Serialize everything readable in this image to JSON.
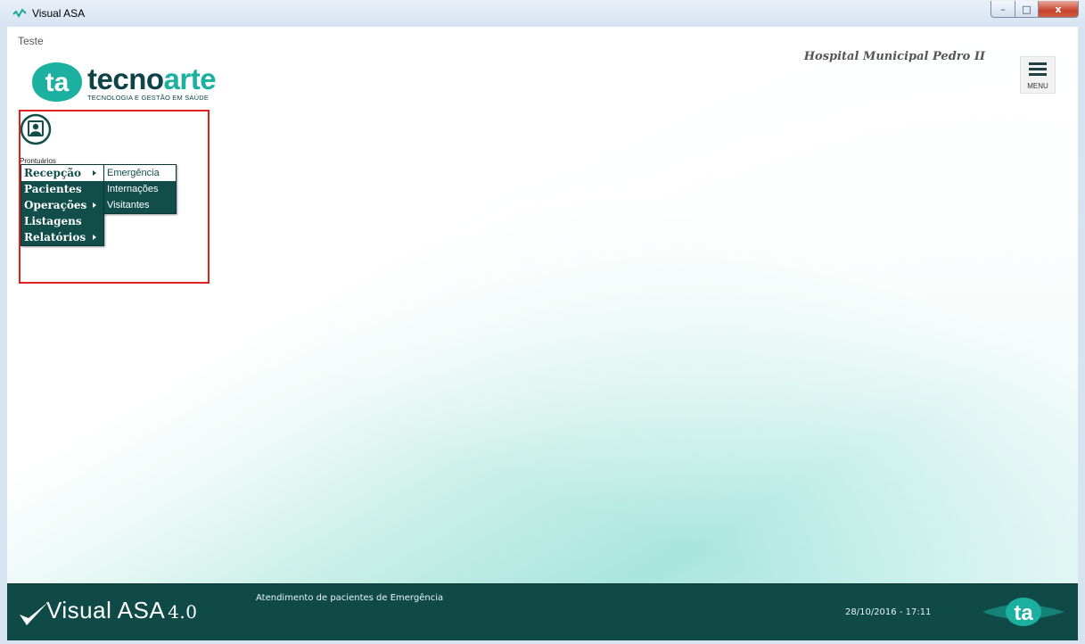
{
  "window": {
    "title": "Visual ASA",
    "controls": {
      "minimize": "–",
      "maximize": "□",
      "close": "x"
    }
  },
  "header": {
    "environment_label": "Teste",
    "hospital_name": "Hospital Municipal Pedro II",
    "menu_button_label": "MENU",
    "logo": {
      "mark_text": "ta",
      "name_dark": "tecno",
      "name_accent": "arte",
      "tagline": "TECNOLOGIA E GESTÃO EM SAÚDE"
    }
  },
  "shortcut": {
    "label": "Prontuários",
    "icon": "patient-record-icon"
  },
  "menu": {
    "items": [
      {
        "label": "Recepção",
        "has_submenu": true,
        "active": true
      },
      {
        "label": "Pacientes",
        "has_submenu": false
      },
      {
        "label": "Operações",
        "has_submenu": true
      },
      {
        "label": "Listagens",
        "has_submenu": false
      },
      {
        "label": "Relatórios",
        "has_submenu": true
      }
    ],
    "submenu": [
      {
        "label": "Emergência",
        "active": true
      },
      {
        "label": "Internações"
      },
      {
        "label": "Visitantes"
      }
    ]
  },
  "footer": {
    "brand": "Visual ASA",
    "version": "4.0",
    "status": "Atendimento de pacientes de Emergência",
    "datetime": "28/10/2016 - 17:11",
    "logo_text": "ta"
  },
  "colors": {
    "primary_dark": "#114e4a",
    "footer_bg": "#0f4a47",
    "accent": "#1bb0a0",
    "highlight_border": "#e0201e"
  }
}
